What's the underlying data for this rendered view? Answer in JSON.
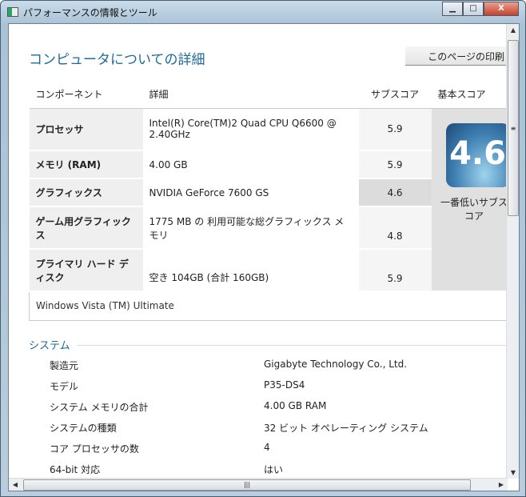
{
  "window": {
    "title": "パフォーマンスの情報とツール",
    "minimize": "▁",
    "maximize": "□",
    "close": "X"
  },
  "heading": "コンピュータについての詳細",
  "print_button": "このページの印刷",
  "table": {
    "headers": [
      "コンポーネント",
      "詳細",
      "サブスコア",
      "基本スコア"
    ],
    "rows": [
      {
        "component": "プロセッサ",
        "detail": "Intel(R) Core(TM)2 Quad CPU Q6600 @ 2.40GHz",
        "subscore": "5.9"
      },
      {
        "component": "メモリ (RAM)",
        "detail": "4.00 GB",
        "subscore": "5.9"
      },
      {
        "component": "グラフィックス",
        "detail": "NVIDIA GeForce 7600 GS",
        "subscore": "4.6"
      },
      {
        "component": "ゲーム用グラフィックス",
        "detail": "1775 MB の 利用可能な総グラフィックス メモリ",
        "subscore": "4.8"
      },
      {
        "component": "プライマリ ハード ディスク",
        "detail": "空き 104GB (合計 160GB)",
        "subscore": "5.9"
      }
    ],
    "base_score": "4.6",
    "base_caption": "一番低いサブスコア",
    "footer": "Windows Vista (TM) Ultimate"
  },
  "system": {
    "title": "システム",
    "items": [
      {
        "label": "製造元",
        "value": "Gigabyte Technology Co., Ltd."
      },
      {
        "label": "モデル",
        "value": "P35-DS4"
      },
      {
        "label": "システム メモリの合計",
        "value": "4.00 GB RAM"
      },
      {
        "label": "システムの種類",
        "value": "32 ビット オペレーティング システム"
      },
      {
        "label": "コア プロセッサの数",
        "value": "4"
      },
      {
        "label": "64-bit 対応",
        "value": "はい"
      }
    ]
  }
}
